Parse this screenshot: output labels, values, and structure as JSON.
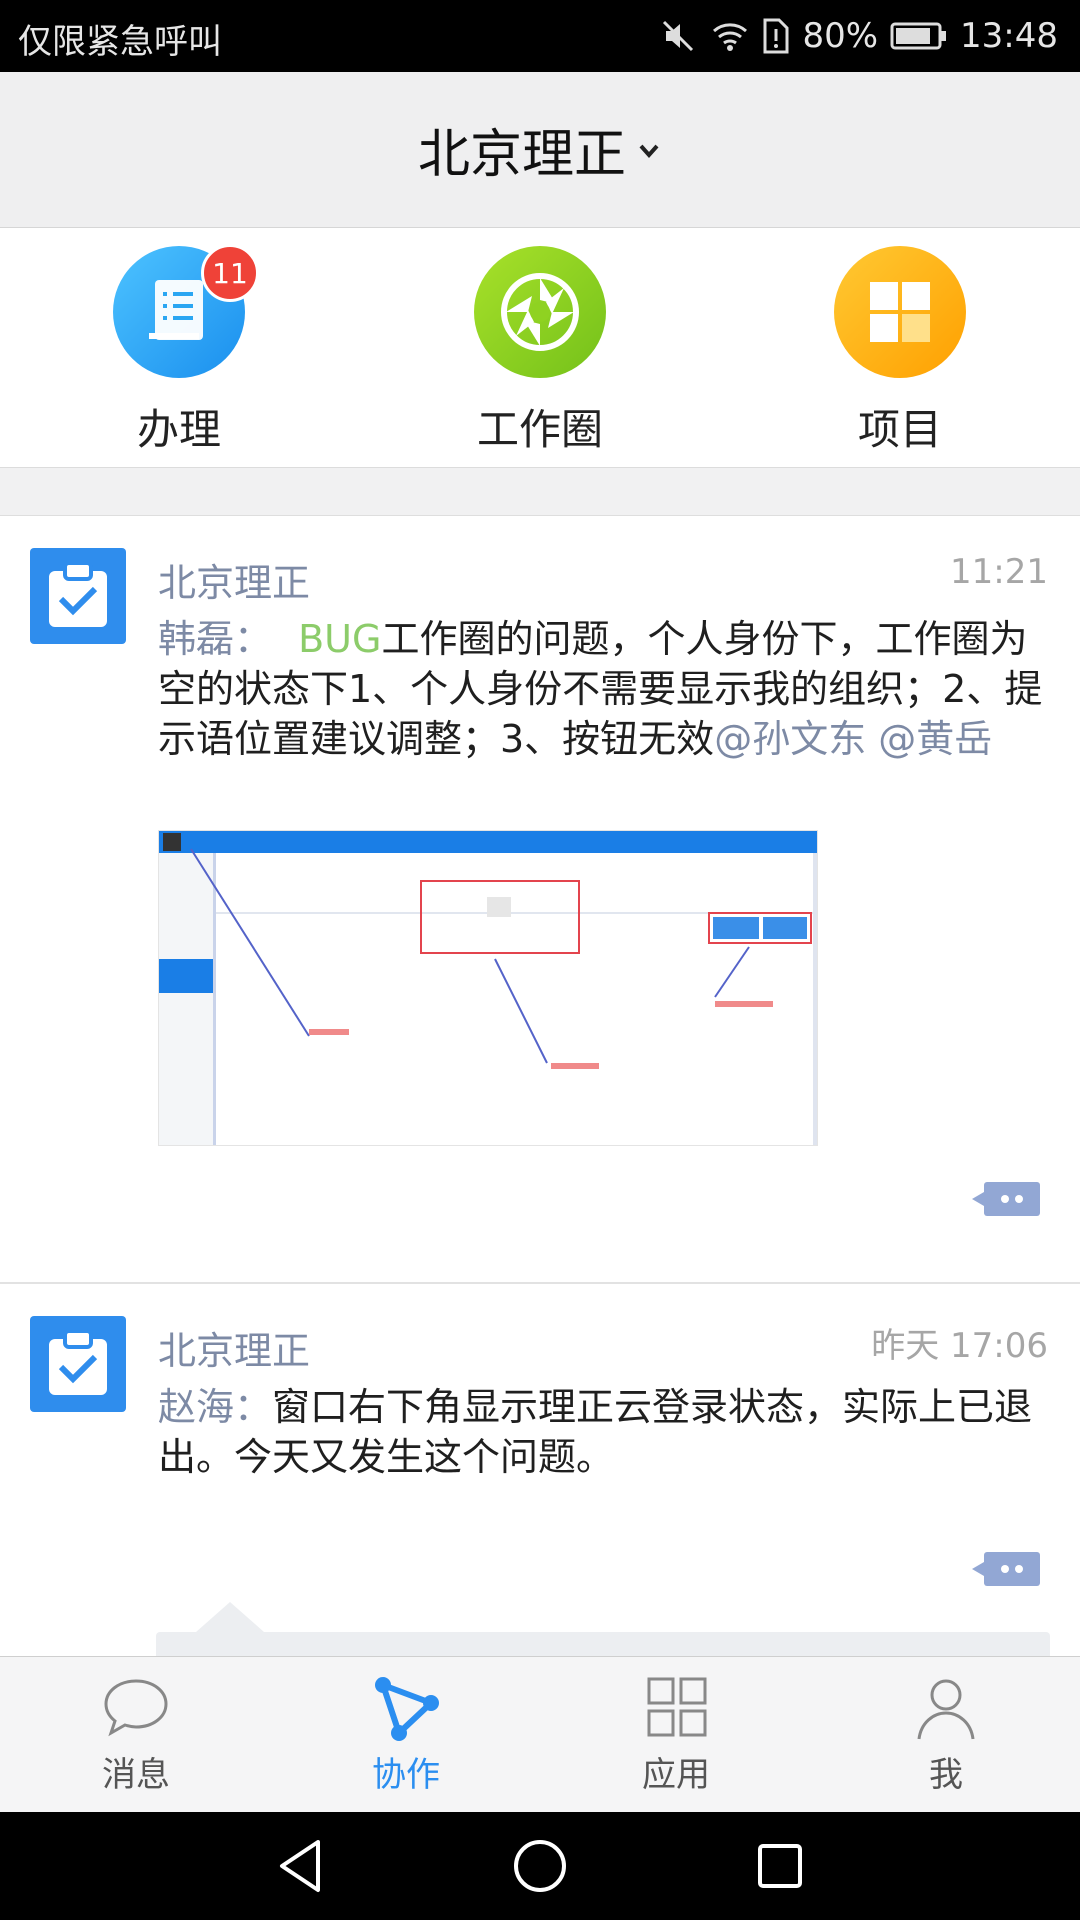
{
  "status_bar": {
    "carrier": "仅限紧急呼叫",
    "battery": "80%",
    "time": "13:48"
  },
  "header": {
    "title": "北京理正"
  },
  "quick_apps": [
    {
      "label": "办理",
      "badge": "11",
      "color": "#2aa6f2"
    },
    {
      "label": "工作圈",
      "color": "#8fd221"
    },
    {
      "label": "项目",
      "color": "#ffb400"
    }
  ],
  "posts": [
    {
      "org": "北京理正",
      "time": "11:21",
      "author": "韩磊：",
      "tag": "BUG",
      "text": "工作圈的问题，个人身份下，工作圈为空的状态下1、个人身份不需要显示我的组织；2、提示语位置建议调整；3、按钮无效",
      "mentions": "@孙文东 @黄岳"
    },
    {
      "org": "北京理正",
      "time": "昨天 17:06",
      "author": "赵海：",
      "text": "窗口右下角显示理正云登录状态，实际上已退出。今天又发生这个问题。"
    }
  ],
  "tabbar": {
    "tabs": [
      {
        "label": "消息"
      },
      {
        "label": "协作",
        "active": true
      },
      {
        "label": "应用"
      },
      {
        "label": "我"
      }
    ],
    "active_color": "#2b8ef0"
  }
}
